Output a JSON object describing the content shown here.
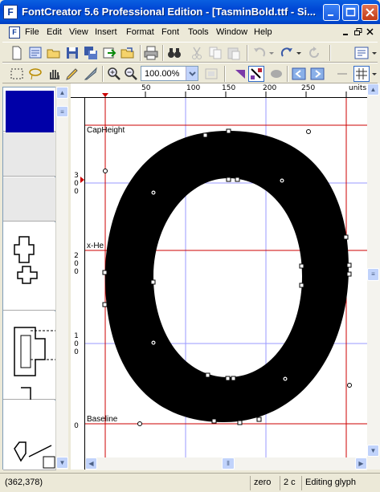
{
  "window": {
    "title": "FontCreator 5.6 Professional Edition - [TasminBold.ttf - Si...",
    "app_icon": "F"
  },
  "menubar": {
    "items": [
      "File",
      "Edit",
      "View",
      "Insert",
      "Format",
      "Font",
      "Tools",
      "Window",
      "Help"
    ]
  },
  "toolbar": {
    "zoom": "100.00%"
  },
  "ruler": {
    "top_labels": [
      "50",
      "100",
      "150",
      "200",
      "250",
      "units"
    ],
    "left_labels": [
      {
        "lines": [
          "3",
          "0",
          "0"
        ]
      },
      {
        "lines": [
          "2",
          "0",
          "0"
        ]
      },
      {
        "lines": [
          "1",
          "0",
          "0"
        ]
      },
      {
        "lines": [
          "0"
        ]
      }
    ]
  },
  "guides": {
    "cap_height": "CapHeight",
    "x_height": "x-He",
    "baseline": "Baseline"
  },
  "glyph": {
    "name": "zero"
  },
  "statusbar": {
    "coords": "(362,378)",
    "glyph_name": "zero",
    "contours": "2 c",
    "mode": "Editing glyph"
  },
  "colors": {
    "title_bar": "#0046d5",
    "guide_red": "#cc0000",
    "grid_blue": "#8080ff",
    "selected_glyph": "#0000a8"
  }
}
